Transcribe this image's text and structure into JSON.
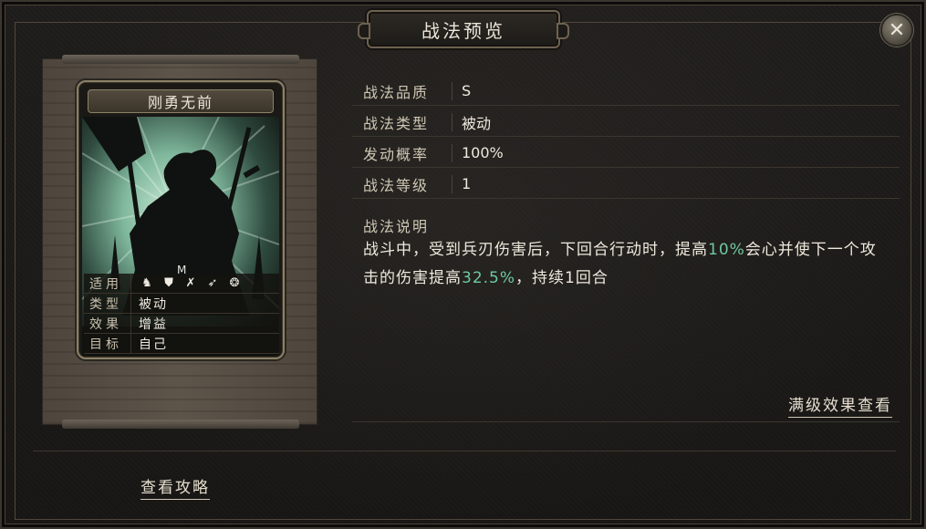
{
  "dialog": {
    "title": "战法预览",
    "close_icon": "close-x-icon"
  },
  "card": {
    "name": "刚勇无前",
    "stats": [
      {
        "key": "适用",
        "icons": [
          "cavalry-icon",
          "shield-icon",
          "bow-icon",
          "spear-icon",
          "wheel-icon"
        ]
      },
      {
        "key": "类型",
        "value": "被动"
      },
      {
        "key": "效果",
        "value": "增益"
      },
      {
        "key": "目标",
        "value": "自己"
      }
    ]
  },
  "info": {
    "rows": [
      {
        "key": "战法品质",
        "value": "S"
      },
      {
        "key": "战法类型",
        "value": "被动"
      },
      {
        "key": "发动概率",
        "value": "100%"
      },
      {
        "key": "战法等级",
        "value": "1"
      }
    ],
    "desc_title": "战法说明",
    "desc_parts": [
      {
        "text": "战斗中，受到兵刃伤害后，下回合行动时，提高",
        "hl": false
      },
      {
        "text": "10%",
        "hl": true
      },
      {
        "text": "会心并使下一个攻击的伤害提高",
        "hl": false
      },
      {
        "text": "32.5%",
        "hl": true
      },
      {
        "text": "，持续1回合",
        "hl": false
      }
    ],
    "highlight_color": "#6fc8a0",
    "max_level_link": "满级效果查看"
  },
  "footer": {
    "guide_link": "查看攻略"
  }
}
